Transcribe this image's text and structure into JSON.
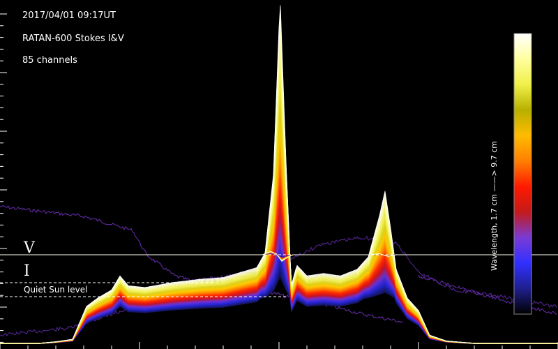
{
  "header": {
    "timestamp": "2017/04/01 09:17UT",
    "instrument": "RATAN-600 Stokes I&V",
    "channels": "85 channels"
  },
  "colorbar": {
    "label": "Wavelength,  1.7 cm  ——>  9.7 cm",
    "stops": [
      "#000000",
      "#1f1f8f",
      "#3030ff",
      "#7a3bd6",
      "#c41a1a",
      "#ff1a00",
      "#ff7f00",
      "#ffbb00",
      "#b8b000",
      "#f0f04a",
      "#ffff9e",
      "#ffffff"
    ]
  },
  "labels": {
    "v": "V",
    "i": "I",
    "quiet_sun": "Quiet Sun level"
  },
  "chart_data": {
    "type": "line",
    "title": "RATAN-600 Stokes I&V",
    "channel_count": 85,
    "wavelength_range_cm": [
      1.7,
      9.7
    ],
    "grid": false,
    "legend": "colorbar right",
    "series": [
      {
        "name": "I",
        "profile": [
          {
            "x": 0.0,
            "y": 0.0
          },
          {
            "x": 0.07,
            "y": 0.0
          },
          {
            "x": 0.1,
            "y": 0.02
          },
          {
            "x": 0.13,
            "y": 0.05
          },
          {
            "x": 0.155,
            "y": 0.45
          },
          {
            "x": 0.175,
            "y": 0.55
          },
          {
            "x": 0.2,
            "y": 0.65
          },
          {
            "x": 0.215,
            "y": 0.82
          },
          {
            "x": 0.23,
            "y": 0.7
          },
          {
            "x": 0.26,
            "y": 0.68
          },
          {
            "x": 0.31,
            "y": 0.74
          },
          {
            "x": 0.36,
            "y": 0.78
          },
          {
            "x": 0.4,
            "y": 0.8
          },
          {
            "x": 0.43,
            "y": 0.86
          },
          {
            "x": 0.46,
            "y": 0.92
          },
          {
            "x": 0.475,
            "y": 1.1
          },
          {
            "x": 0.49,
            "y": 2.05
          },
          {
            "x": 0.502,
            "y": 4.2
          },
          {
            "x": 0.512,
            "y": 2.3
          },
          {
            "x": 0.522,
            "y": 0.7
          },
          {
            "x": 0.532,
            "y": 0.95
          },
          {
            "x": 0.55,
            "y": 0.82
          },
          {
            "x": 0.58,
            "y": 0.85
          },
          {
            "x": 0.61,
            "y": 0.82
          },
          {
            "x": 0.64,
            "y": 0.9
          },
          {
            "x": 0.66,
            "y": 1.05
          },
          {
            "x": 0.68,
            "y": 1.55
          },
          {
            "x": 0.69,
            "y": 1.85
          },
          {
            "x": 0.7,
            "y": 1.4
          },
          {
            "x": 0.71,
            "y": 0.9
          },
          {
            "x": 0.73,
            "y": 0.55
          },
          {
            "x": 0.75,
            "y": 0.4
          },
          {
            "x": 0.77,
            "y": 0.1
          },
          {
            "x": 0.8,
            "y": 0.03
          },
          {
            "x": 0.85,
            "y": 0.0
          },
          {
            "x": 1.0,
            "y": 0.0
          }
        ]
      },
      {
        "name": "V",
        "profile": [
          {
            "x": 0.0,
            "y": 0.0
          },
          {
            "x": 0.47,
            "y": 0.0
          },
          {
            "x": 0.485,
            "y": 0.06
          },
          {
            "x": 0.495,
            "y": 0.02
          },
          {
            "x": 0.505,
            "y": -0.12
          },
          {
            "x": 0.515,
            "y": -0.05
          },
          {
            "x": 0.525,
            "y": 0.0
          },
          {
            "x": 0.66,
            "y": 0.0
          },
          {
            "x": 0.68,
            "y": 0.02
          },
          {
            "x": 0.695,
            "y": -0.03
          },
          {
            "x": 0.71,
            "y": 0.0
          },
          {
            "x": 1.0,
            "y": 0.0
          }
        ]
      }
    ]
  }
}
